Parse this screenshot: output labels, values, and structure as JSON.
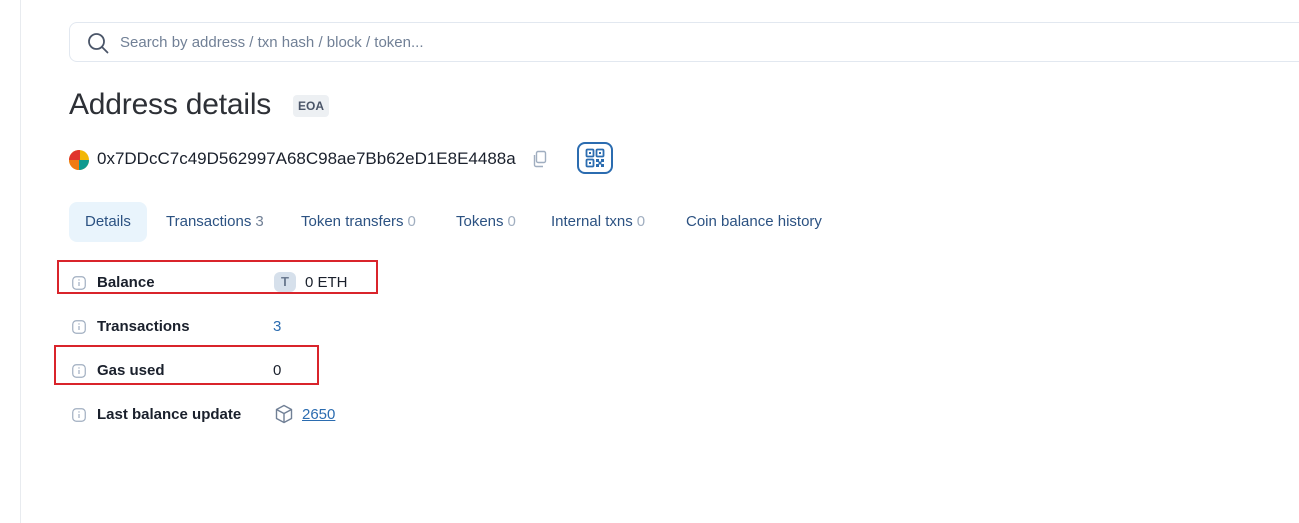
{
  "search": {
    "placeholder": "Search by address / txn hash / block / token..."
  },
  "page": {
    "title": "Address details",
    "type_badge": "EOA",
    "address": "0x7DDcC7c49D562997A68C98ae7Bb62eD1E8E4488a"
  },
  "tabs": [
    {
      "label": "Details",
      "count": ""
    },
    {
      "label": "Transactions",
      "count": "3"
    },
    {
      "label": "Token transfers",
      "count": "0"
    },
    {
      "label": "Tokens",
      "count": "0"
    },
    {
      "label": "Internal txns",
      "count": "0"
    },
    {
      "label": "Coin balance history",
      "count": ""
    }
  ],
  "details": {
    "balance": {
      "label": "Balance",
      "token_letter": "T",
      "value": "0 ETH"
    },
    "transactions": {
      "label": "Transactions",
      "value": "3"
    },
    "gas_used": {
      "label": "Gas used",
      "value": "0"
    },
    "last_balance_update": {
      "label": "Last balance update",
      "value": "2650"
    }
  },
  "colors": {
    "accent": "#2b6cb0",
    "highlight_box": "#d9242b",
    "active_tab_bg": "#e9f4fc"
  },
  "icons": [
    "search-icon",
    "copy-icon",
    "qr-code-icon",
    "info-icon",
    "block-cube-icon",
    "address-avatar-icon"
  ]
}
